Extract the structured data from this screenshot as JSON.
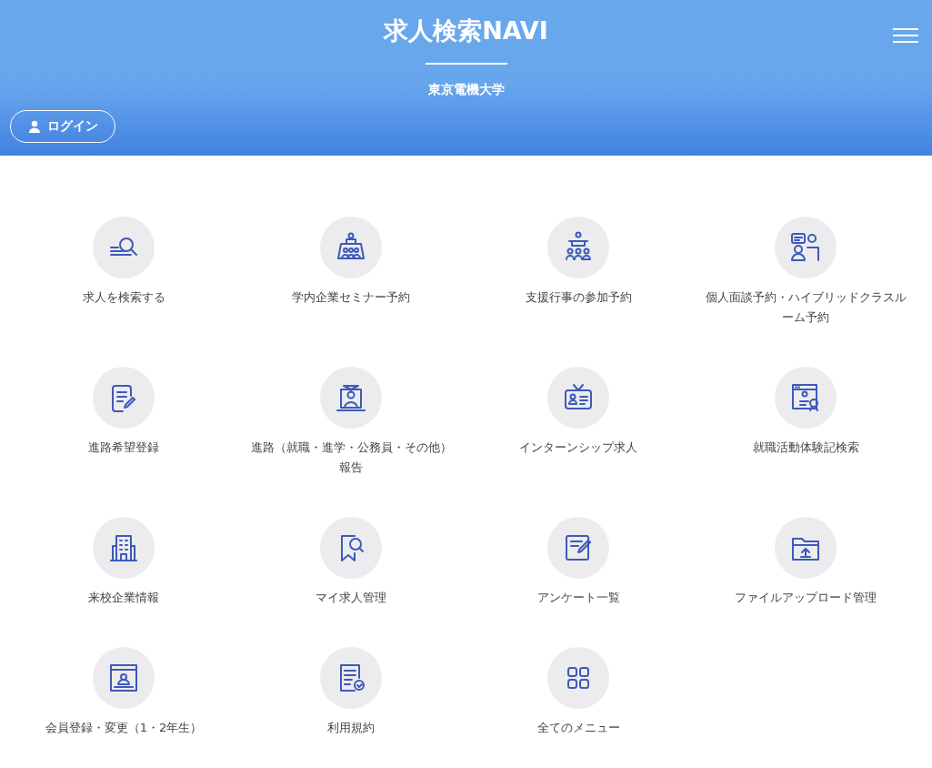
{
  "header": {
    "title": "求人検索NAVI",
    "subtitle": "東京電機大学",
    "login_button": "ログイン"
  },
  "menu": [
    {
      "label": "求人を検索する",
      "kind": "search"
    },
    {
      "label": "学内企業セミナー予約",
      "kind": "seminar"
    },
    {
      "label": "支援行事の参加予約",
      "kind": "audience"
    },
    {
      "label": "個人面談予約・ハイブリッドクラスルーム予約",
      "kind": "consultation"
    },
    {
      "label": "進路希望登録",
      "kind": "form"
    },
    {
      "label": "進路（就職・進学・公務員・その他）報告",
      "kind": "graduate"
    },
    {
      "label": "インターンシップ求人",
      "kind": "badge"
    },
    {
      "label": "就職活動体験記検索",
      "kind": "certificate"
    },
    {
      "label": "来校企業情報",
      "kind": "building"
    },
    {
      "label": "マイ求人管理",
      "kind": "bookmark"
    },
    {
      "label": "アンケート一覧",
      "kind": "edit"
    },
    {
      "label": "ファイルアップロード管理",
      "kind": "upload"
    },
    {
      "label": "会員登録・変更（1・2年生）",
      "kind": "profile"
    },
    {
      "label": "利用規約",
      "kind": "document"
    },
    {
      "label": "全てのメニュー",
      "kind": "grid"
    }
  ]
}
